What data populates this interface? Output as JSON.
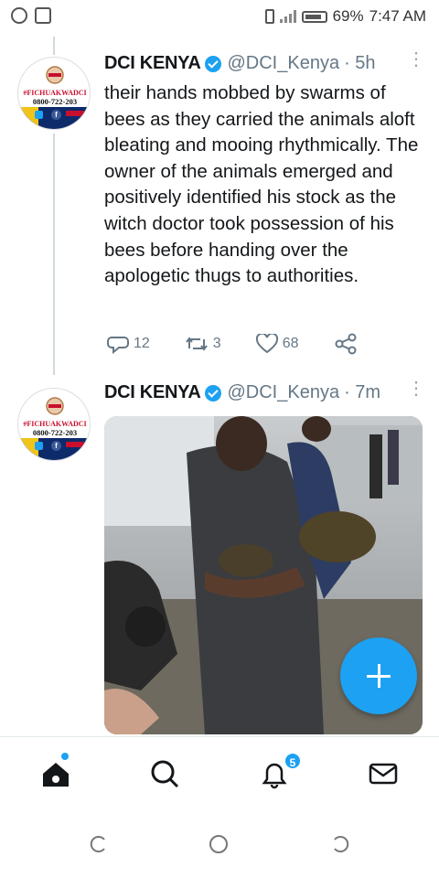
{
  "status_bar": {
    "battery": "69%",
    "time": "7:47 AM"
  },
  "tweets": [
    {
      "avatar": {
        "tagline": "#FICHUAKWADCI",
        "phone": "0800-722-203"
      },
      "name": "DCI KENYA",
      "handle": "@DCI_Kenya",
      "time": "· 5h",
      "text": "their hands mobbed by swarms of bees as they carried the animals aloft bleating and mooing rhythmically. The owner of the animals emerged and positively identified his stock as the witch doctor took possession of his bees before handing over the apologetic thugs to authorities.",
      "replies": "12",
      "retweets": "3",
      "likes": "68"
    },
    {
      "avatar": {
        "tagline": "#FICHUAKWADCI",
        "phone": "0800-722-203"
      },
      "name": "DCI KENYA",
      "handle": "@DCI_Kenya",
      "time": "· 7m"
    }
  ],
  "bottom_nav": {
    "notifications_badge": "5",
    "items": [
      "home-icon",
      "search-icon",
      "bell-icon",
      "mail-icon"
    ]
  },
  "colors": {
    "accent": "#1da1f2",
    "text": "#14171a",
    "secondary_text": "#657786"
  }
}
